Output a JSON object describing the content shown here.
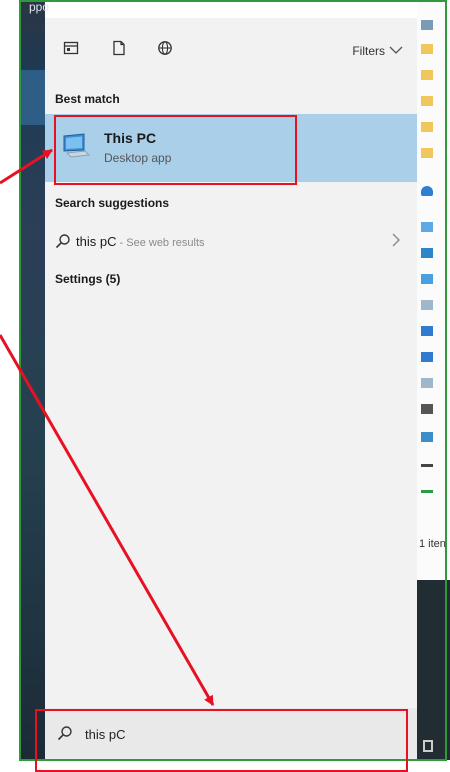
{
  "desktop": {
    "top_label": "ppo"
  },
  "toolbar": {
    "filters_label": "Filters"
  },
  "best_match": {
    "title": "Best match",
    "item_name": "This PC",
    "item_subtitle": "Desktop app"
  },
  "suggestions": {
    "title": "Search suggestions",
    "query": "this pC",
    "hint": " - See web results"
  },
  "settings": {
    "label": "Settings (5)"
  },
  "search": {
    "value": "this pC"
  },
  "explorer": {
    "status_text": "1 iten"
  },
  "colors": {
    "highlight": "#a9cfe9",
    "menu_bg": "#f2f2f2",
    "annotation": "#e81123",
    "frame_border": "#2e9a3c"
  },
  "icons": [
    "calendar-icon",
    "document-icon",
    "globe-icon",
    "chevron-down-icon",
    "computer-icon",
    "search-icon",
    "chevron-right-icon"
  ]
}
